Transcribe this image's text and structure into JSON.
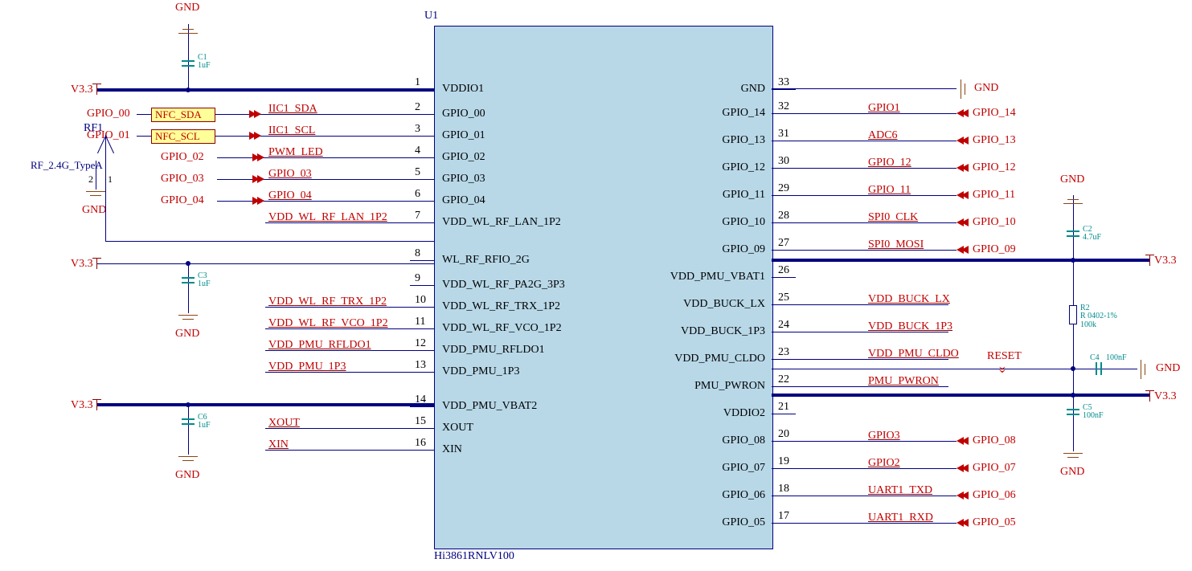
{
  "chip": {
    "ref": "U1",
    "part": "Hi3861RNLV100",
    "left_pins": [
      {
        "num": "1",
        "name": "VDDIO1"
      },
      {
        "num": "2",
        "name": "GPIO_00"
      },
      {
        "num": "3",
        "name": "GPIO_01"
      },
      {
        "num": "4",
        "name": "GPIO_02"
      },
      {
        "num": "5",
        "name": "GPIO_03"
      },
      {
        "num": "6",
        "name": "GPIO_04"
      },
      {
        "num": "7",
        "name": "VDD_WL_RF_LAN_1P2"
      },
      {
        "num": "8",
        "name": "WL_RF_RFIO_2G"
      },
      {
        "num": "9",
        "name": "VDD_WL_RF_PA2G_3P3"
      },
      {
        "num": "10",
        "name": "VDD_WL_RF_TRX_1P2"
      },
      {
        "num": "11",
        "name": "VDD_WL_RF_VCO_1P2"
      },
      {
        "num": "12",
        "name": "VDD_PMU_RFLDO1"
      },
      {
        "num": "13",
        "name": "VDD_PMU_1P3"
      },
      {
        "num": "14",
        "name": "VDD_PMU_VBAT2"
      },
      {
        "num": "15",
        "name": "XOUT"
      },
      {
        "num": "16",
        "name": "XIN"
      }
    ],
    "right_pins": [
      {
        "num": "33",
        "name": "GND"
      },
      {
        "num": "32",
        "name": "GPIO_14"
      },
      {
        "num": "31",
        "name": "GPIO_13"
      },
      {
        "num": "30",
        "name": "GPIO_12"
      },
      {
        "num": "29",
        "name": "GPIO_11"
      },
      {
        "num": "28",
        "name": "GPIO_10"
      },
      {
        "num": "27",
        "name": "GPIO_09"
      },
      {
        "num": "26",
        "name": "VDD_PMU_VBAT1"
      },
      {
        "num": "25",
        "name": "VDD_BUCK_LX"
      },
      {
        "num": "24",
        "name": "VDD_BUCK_1P3"
      },
      {
        "num": "23",
        "name": "VDD_PMU_CLDO"
      },
      {
        "num": "22",
        "name": "PMU_PWRON"
      },
      {
        "num": "21",
        "name": "VDDIO2"
      },
      {
        "num": "20",
        "name": "GPIO_08"
      },
      {
        "num": "19",
        "name": "GPIO_07"
      },
      {
        "num": "18",
        "name": "GPIO_06"
      },
      {
        "num": "17",
        "name": "GPIO_05"
      }
    ]
  },
  "left_nets": {
    "2": {
      "net": "IIC1_SDA",
      "port": "GPIO_00",
      "tag": "NFC_SDA"
    },
    "3": {
      "net": "IIC1_SCL",
      "port": "GPIO_01",
      "tag": "NFC_SCL"
    },
    "4": {
      "net": "PWM_LED",
      "port": "GPIO_02"
    },
    "5": {
      "net": "GPIO_03",
      "port": "GPIO_03"
    },
    "6": {
      "net": "GPIO_04",
      "port": "GPIO_04"
    },
    "7": {
      "net": "VDD_WL_RF_LAN_1P2"
    },
    "10": {
      "net": "VDD_WL_RF_TRX_1P2"
    },
    "11": {
      "net": "VDD_WL_RF_VCO_1P2"
    },
    "12": {
      "net": "VDD_PMU_RFLDO1"
    },
    "13": {
      "net": "VDD_PMU_1P3"
    },
    "15": {
      "net": "XOUT"
    },
    "16": {
      "net": "XIN"
    }
  },
  "right_nets": {
    "32": {
      "net": "GPIO1",
      "port": "GPIO_14"
    },
    "31": {
      "net": "ADC6",
      "port": "GPIO_13"
    },
    "30": {
      "net": "GPIO_12",
      "port": "GPIO_12"
    },
    "29": {
      "net": "GPIO_11",
      "port": "GPIO_11"
    },
    "28": {
      "net": "SPI0_CLK",
      "port": "GPIO_10"
    },
    "27": {
      "net": "SPI0_MOSI",
      "port": "GPIO_09"
    },
    "25": {
      "net": "VDD_BUCK_LX"
    },
    "24": {
      "net": "VDD_BUCK_1P3"
    },
    "23": {
      "net": "VDD_PMU_CLDO"
    },
    "22": {
      "net": "PMU_PWRON",
      "extra": "RESET"
    },
    "20": {
      "net": "GPIO3",
      "port": "GPIO_08"
    },
    "19": {
      "net": "GPIO2",
      "port": "GPIO_07"
    },
    "18": {
      "net": "UART1_TXD",
      "port": "GPIO_06"
    },
    "17": {
      "net": "UART1_RXD",
      "port": "GPIO_05"
    }
  },
  "power": {
    "v33": "V3.3",
    "gnd": "GND"
  },
  "components": {
    "c1": {
      "ref": "C1",
      "val": "1uF"
    },
    "c2": {
      "ref": "C2",
      "val": "4.7uF"
    },
    "c3": {
      "ref": "C3",
      "val": "1uF"
    },
    "c4": {
      "ref": "C4",
      "val": "100nF"
    },
    "c5": {
      "ref": "C5",
      "val": "100nF"
    },
    "c6": {
      "ref": "C6",
      "val": "1uF"
    },
    "r2": {
      "ref": "R2",
      "val": "R 0402-1%\n100k"
    },
    "rf1": {
      "ref": "RF1",
      "val": "RF_2.4G_TypeA",
      "p1": "1",
      "p2": "2"
    }
  }
}
